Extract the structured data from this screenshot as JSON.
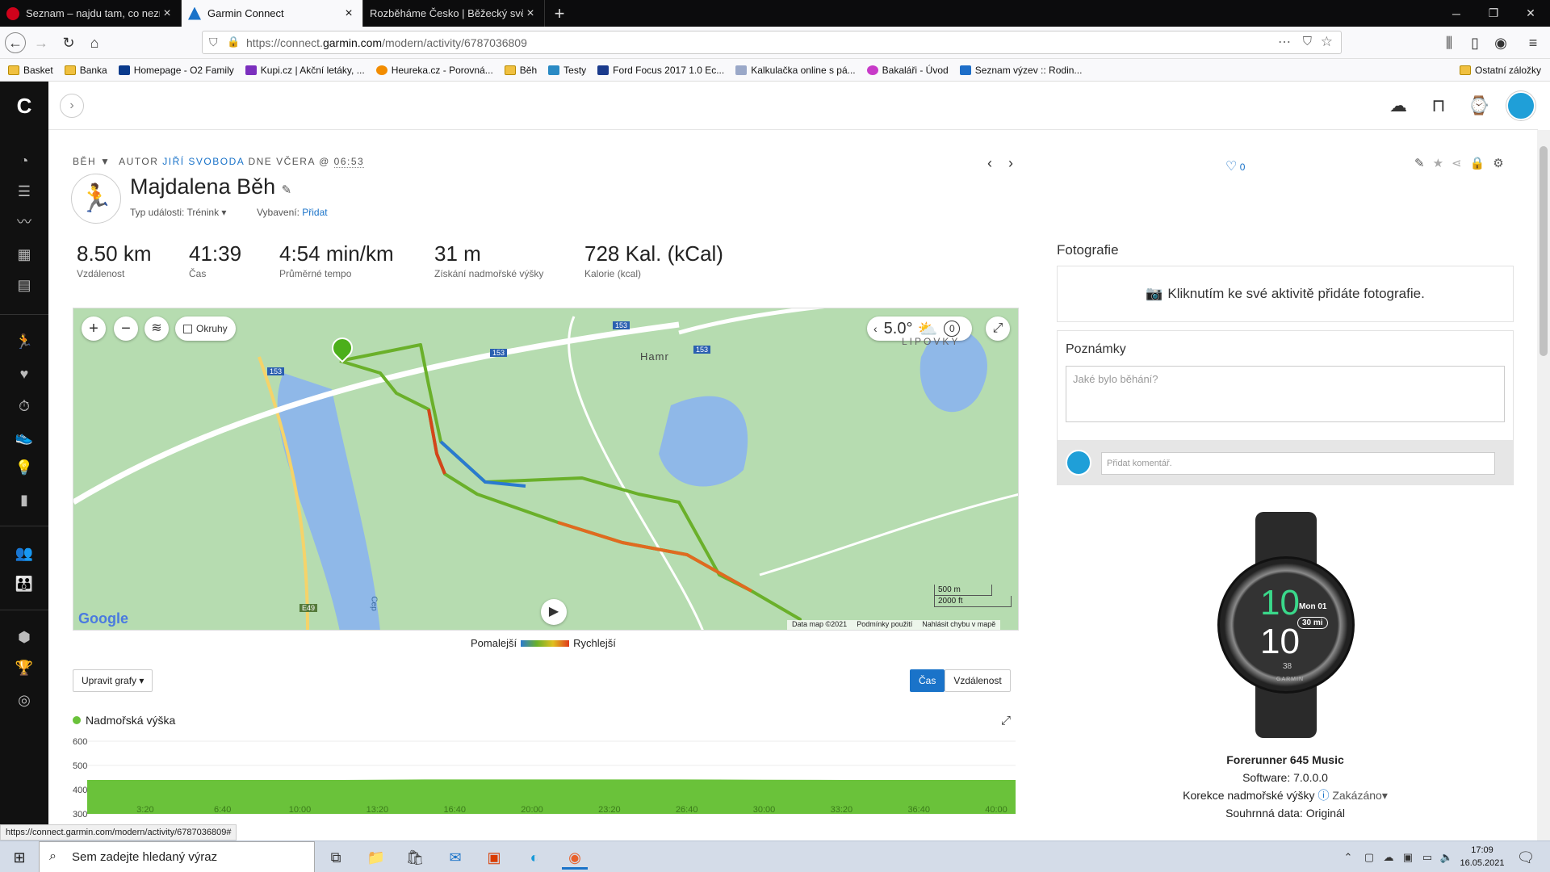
{
  "browser": {
    "tabs": [
      {
        "title": "Seznam – najdu tam, co neznám",
        "color": "#d0021b",
        "active": false
      },
      {
        "title": "Garmin Connect",
        "color": "#1a73c9",
        "active": true
      },
      {
        "title": "Rozběháme Česko | Běžecký svět | B",
        "color": "#555",
        "active": false
      }
    ],
    "url_prefix": "https://connect.",
    "url_domain": "garmin.com",
    "url_path": "/modern/activity/6787036809",
    "bookmarks": [
      {
        "label": "Basket",
        "icon": "folder"
      },
      {
        "label": "Banka",
        "icon": "folder"
      },
      {
        "label": "Homepage - O2 Family",
        "icon": "o2"
      },
      {
        "label": "Kupi.cz | Akční letáky, ...",
        "icon": "kupi"
      },
      {
        "label": "Heureka.cz - Porovná...",
        "icon": "heureka"
      },
      {
        "label": "Běh",
        "icon": "folder"
      },
      {
        "label": "Testy",
        "icon": "testy"
      },
      {
        "label": "Ford Focus 2017 1.0 Ec...",
        "icon": "ford"
      },
      {
        "label": "Kalkulačka online s pá...",
        "icon": "kalk"
      },
      {
        "label": "Bakaláři - Úvod",
        "icon": "bak"
      },
      {
        "label": "Seznam výzev :: Rodin...",
        "icon": "wn"
      }
    ],
    "other_bookmarks": "Ostatní záložky",
    "status_url": "https://connect.garmin.com/modern/activity/6787036809#"
  },
  "activity": {
    "type": "BĚH",
    "author_prefix": "AUTOR",
    "author": "JIŘÍ SVOBODA",
    "date_prefix": "DNE VČERA @",
    "time": "06:53",
    "title": "Majdalena Běh",
    "event_type_label": "Typ události:",
    "event_type_value": "Trénink",
    "equipment_label": "Vybavení:",
    "equipment_link": "Přidat",
    "likes": "0",
    "stats": [
      {
        "value": "8.50 km",
        "label": "Vzdálenost"
      },
      {
        "value": "41:39",
        "label": "Čas"
      },
      {
        "value": "4:54 min/km",
        "label": "Průměrné tempo"
      },
      {
        "value": "31 m",
        "label": "Získání nadmořské výšky"
      },
      {
        "value": "728 Kal. (kCal)",
        "label": "Kalorie (kcal)"
      }
    ]
  },
  "map": {
    "laps_label": "Okruhy",
    "temperature": "5.0°",
    "wind": "0",
    "place_hamr": "Hamr",
    "place_lipovky": "LIPOVKY",
    "river": "Cep",
    "road_153": "153",
    "road_e49": "E49",
    "scale_m": "500 m",
    "scale_ft": "2000 ft",
    "footer": [
      "Data map ©2021",
      "Podmínky použití",
      "Nahlásit chybu v mapě"
    ],
    "logo": "Google",
    "legend_slow": "Pomalejší",
    "legend_fast": "Rychlejší"
  },
  "charts": {
    "edit_button": "Upravit grafy",
    "toggle_time": "Čas",
    "toggle_distance": "Vzdálenost",
    "elevation_title": "Nadmořská výška",
    "elevation_color": "#6ac23a"
  },
  "chart_data": {
    "type": "area",
    "ylabel": "",
    "xlabel": "",
    "ylim": [
      300,
      600
    ],
    "y_ticks": [
      "600",
      "500",
      "400",
      "300"
    ],
    "x_ticks": [
      "3:20",
      "6:40",
      "10:00",
      "13:20",
      "16:40",
      "20:00",
      "23:20",
      "26:40",
      "30:00",
      "33:20",
      "36:40",
      "40:00"
    ],
    "series": [
      {
        "values": [
          440,
          440,
          440,
          440,
          442,
          442,
          442,
          442,
          441,
          440,
          440,
          440
        ]
      }
    ]
  },
  "photos": {
    "title": "Fotografie",
    "add_text": "Kliknutím ke své aktivitě přidáte fotografie."
  },
  "notes": {
    "title": "Poznámky",
    "placeholder": "Jaké bylo běhání?",
    "comment_placeholder": "Přidat komentář."
  },
  "device": {
    "name": "Forerunner 645 Music",
    "software": "Software: 7.0.0.0",
    "elev_corr_label": "Korekce nadmořské výšky",
    "elev_corr_value": "Zakázáno",
    "summary": "Souhrnná data: Originál",
    "watch_hour": "10",
    "watch_min": "10",
    "watch_sec": "38",
    "watch_date": "Mon 01",
    "watch_dist": "30 mi",
    "watch_brand": "GARMIN"
  },
  "taskbar": {
    "search_placeholder": "Sem zadejte hledaný výraz",
    "time": "17:09",
    "date": "16.05.2021"
  }
}
